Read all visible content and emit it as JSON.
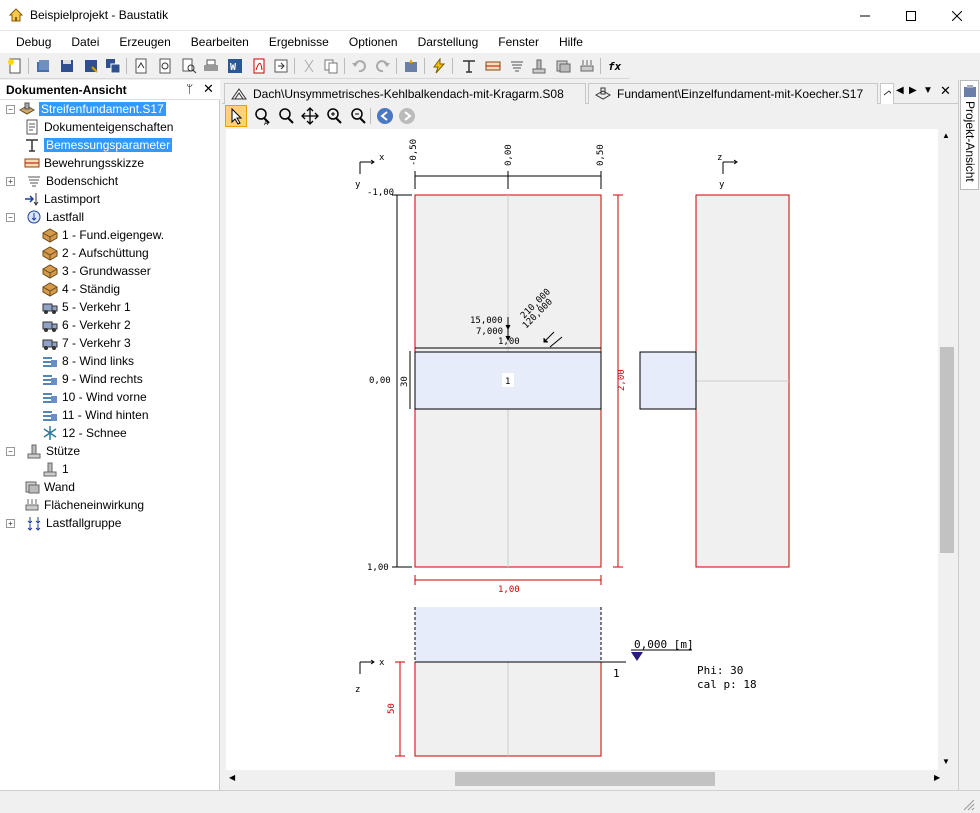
{
  "window": {
    "title": "Beispielprojekt - Baustatik"
  },
  "menu": [
    "Debug",
    "Datei",
    "Erzeugen",
    "Bearbeiten",
    "Ergebnisse",
    "Optionen",
    "Darstellung",
    "Fenster",
    "Hilfe"
  ],
  "doc_panel": {
    "title": "Dokumenten-Ansicht",
    "root": "Streifenfundament.S17",
    "items": [
      {
        "label": "Dokumenteigenschaften",
        "indent": 1,
        "icon": "document-properties-icon"
      },
      {
        "label": "Bemessungsparameter",
        "indent": 1,
        "icon": "design-parameters-icon",
        "selected": true
      },
      {
        "label": "Bewehrungsskizze",
        "indent": 1,
        "icon": "reinforcement-sketch-icon"
      },
      {
        "label": "Bodenschicht",
        "indent": 1,
        "icon": "soil-layer-icon",
        "expander": "+"
      },
      {
        "label": "Lastimport",
        "indent": 1,
        "icon": "load-import-icon"
      },
      {
        "label": "Lastfall",
        "indent": 1,
        "icon": "load-case-icon",
        "expander": "-"
      },
      {
        "label": "1 - Fund.eigengew.",
        "indent": 2,
        "icon": "box-load-icon"
      },
      {
        "label": "2 - Aufschüttung",
        "indent": 2,
        "icon": "box-load-icon"
      },
      {
        "label": "3 - Grundwasser",
        "indent": 2,
        "icon": "box-load-icon"
      },
      {
        "label": "4 - Ständig",
        "indent": 2,
        "icon": "box-load-icon"
      },
      {
        "label": "5 - Verkehr 1",
        "indent": 2,
        "icon": "truck-load-icon"
      },
      {
        "label": "6 - Verkehr 2",
        "indent": 2,
        "icon": "truck-load-icon"
      },
      {
        "label": "7 - Verkehr 3",
        "indent": 2,
        "icon": "truck-load-icon"
      },
      {
        "label": "8 - Wind links",
        "indent": 2,
        "icon": "wind-load-icon"
      },
      {
        "label": "9 - Wind rechts",
        "indent": 2,
        "icon": "wind-load-icon"
      },
      {
        "label": "10 - Wind vorne",
        "indent": 2,
        "icon": "wind-load-icon"
      },
      {
        "label": "11 - Wind hinten",
        "indent": 2,
        "icon": "wind-load-icon"
      },
      {
        "label": "12 - Schnee",
        "indent": 2,
        "icon": "snow-load-icon"
      },
      {
        "label": "Stütze",
        "indent": 1,
        "icon": "column-icon",
        "expander": "-"
      },
      {
        "label": "1",
        "indent": 2,
        "icon": "column-item-icon"
      },
      {
        "label": "Wand",
        "indent": 1,
        "icon": "wall-icon"
      },
      {
        "label": "Flächeneinwirkung",
        "indent": 1,
        "icon": "area-load-icon"
      },
      {
        "label": "Lastfallgruppe",
        "indent": 1,
        "icon": "load-group-icon",
        "expander": "+"
      }
    ]
  },
  "tabs": [
    {
      "label": "Dach\\Unsymmetrisches-Kehlbalkendach-mit-Kragarm.S08",
      "active": false
    },
    {
      "label": "Fundament\\Einzelfundament-mit-Koecher.S17",
      "active": false
    }
  ],
  "right_panel": {
    "label": "Projekt-Ansicht"
  },
  "drawing": {
    "x_axis": "x",
    "y_axis": "y",
    "z_axis": "z",
    "top_dims": [
      "-0,50",
      "0,00",
      "0,50"
    ],
    "left_dims": [
      "-1,00",
      "0,00",
      "1,00"
    ],
    "height_dim": "2,00",
    "width_dim": "1,00",
    "column_thickness": "30",
    "column_label": "1",
    "loads": [
      "15,000",
      "7,000",
      "1,00",
      "210,000",
      "120,000"
    ],
    "depth_dim": "50",
    "level": "0,000 [m]",
    "soil_label": "1",
    "phi": "Phi:   30",
    "cal_p": "cal p: 18"
  }
}
